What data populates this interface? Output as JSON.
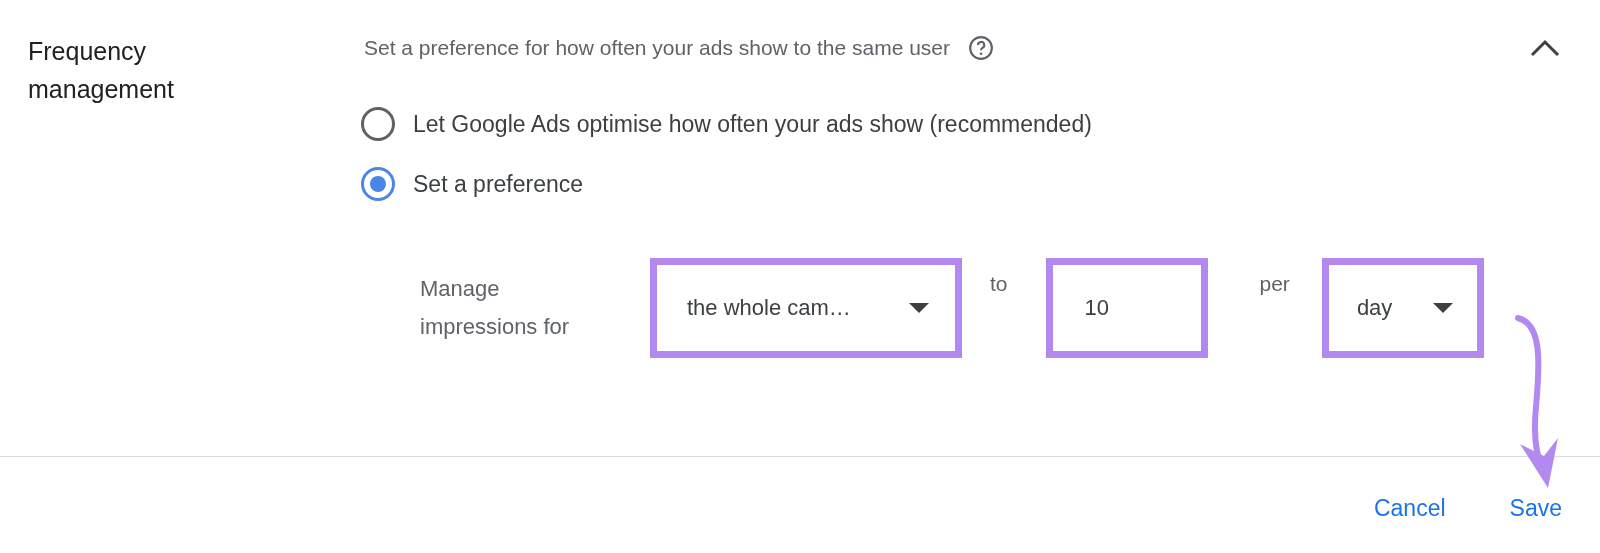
{
  "section": {
    "title": "Frequency management",
    "description": "Set a preference for how often your ads show to the same user",
    "expanded": true
  },
  "options": [
    {
      "label": "Let Google Ads optimise how often your ads show (recommended)",
      "selected": false
    },
    {
      "label": "Set a preference",
      "selected": true
    }
  ],
  "preference": {
    "label": "Manage impressions for",
    "controls": [
      {
        "kind": "dropdown",
        "value": "the whole cam…",
        "highlighted": true
      },
      {
        "kind": "text",
        "value": "to"
      },
      {
        "kind": "input",
        "value": "10",
        "highlighted": true
      },
      {
        "kind": "text",
        "value": "per"
      },
      {
        "kind": "dropdown",
        "value": "day",
        "highlighted": true
      }
    ]
  },
  "buttons": [
    {
      "label": "Cancel"
    },
    {
      "label": "Save"
    }
  ],
  "annotation": {
    "kind": "arrow"
  }
}
